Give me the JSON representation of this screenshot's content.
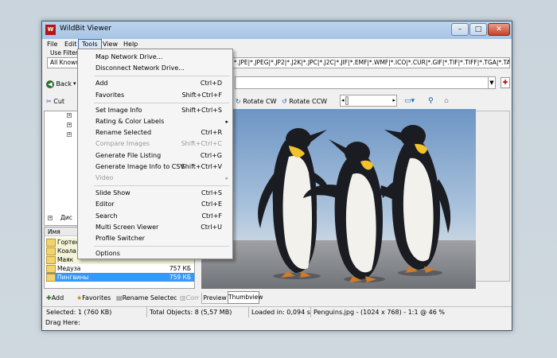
{
  "window": {
    "title": "WildBit Viewer",
    "icon_text": "W"
  },
  "menubar": {
    "items": [
      {
        "label": "File"
      },
      {
        "label": "Edit"
      },
      {
        "label": "Tools"
      },
      {
        "label": "View"
      },
      {
        "label": "Help"
      }
    ]
  },
  "filter": {
    "label": "Use Filter",
    "select_value": "All Known",
    "extensions": "*.JPE|*.JPEG|*.JP2|*.J2K|*.JPC|*.J2C|*.JIF|*.EMF|*.WMF|*.ICO|*.CUR|*.GIF|*.TIF|*.TIFF|*.TGA|*.TARG"
  },
  "nav": {
    "back_label": "Back"
  },
  "toolbar": {
    "cut_label": "Cut",
    "rotate_cw": "Rotate CW",
    "rotate_ccw": "Rotate CCW"
  },
  "tools_menu": {
    "items": [
      {
        "label": "Map Network Drive...",
        "shortcut": "",
        "disabled": false,
        "submenu": false
      },
      {
        "label": "Disconnect Network Drive...",
        "shortcut": "",
        "disabled": false,
        "submenu": false
      },
      {
        "separator": true
      },
      {
        "label": "Add",
        "shortcut": "Ctrl+D",
        "disabled": false,
        "submenu": false
      },
      {
        "label": "Favorites",
        "shortcut": "Shift+Ctrl+F",
        "disabled": false,
        "submenu": false
      },
      {
        "separator": true
      },
      {
        "label": "Set Image Info",
        "shortcut": "Shift+Ctrl+S",
        "disabled": false,
        "submenu": false
      },
      {
        "label": "Rating & Color Labels",
        "shortcut": "",
        "disabled": false,
        "submenu": true
      },
      {
        "label": "Rename Selected",
        "shortcut": "Ctrl+R",
        "disabled": false,
        "submenu": false
      },
      {
        "label": "Compare Images",
        "shortcut": "Shift+Ctrl+C",
        "disabled": true,
        "submenu": false
      },
      {
        "label": "Generate File Listing",
        "shortcut": "Ctrl+G",
        "disabled": false,
        "submenu": false
      },
      {
        "label": "Generate Image Info to CSV",
        "shortcut": "Shift+Ctrl+V",
        "disabled": false,
        "submenu": false
      },
      {
        "label": "Video",
        "shortcut": "",
        "disabled": true,
        "submenu": true
      },
      {
        "separator": true
      },
      {
        "label": "Slide Show",
        "shortcut": "Ctrl+S",
        "disabled": false,
        "submenu": false
      },
      {
        "label": "Editor",
        "shortcut": "Ctrl+E",
        "disabled": false,
        "submenu": false
      },
      {
        "label": "Search",
        "shortcut": "Ctrl+F",
        "disabled": false,
        "submenu": false
      },
      {
        "label": "Multi Screen Viewer",
        "shortcut": "Ctrl+U",
        "disabled": false,
        "submenu": false
      },
      {
        "label": "Profile Switcher",
        "shortcut": "",
        "disabled": false,
        "submenu": false
      },
      {
        "separator": true
      },
      {
        "label": "Options",
        "shortcut": "",
        "disabled": false,
        "submenu": false
      }
    ]
  },
  "file_panel": {
    "tree_label": "Дис",
    "column_name": "Имя",
    "files": [
      {
        "name": "Гортен",
        "size": ""
      },
      {
        "name": "Коала",
        "size": ""
      },
      {
        "name": "Маяк",
        "size": ""
      },
      {
        "name": "Медуза",
        "size": "757 КБ"
      },
      {
        "name": "Пингвины",
        "size": "759 КБ",
        "selected": true
      }
    ]
  },
  "bottom_toolbar": {
    "add": "Add",
    "favorites": "Favorites",
    "rename": "Rename Selected",
    "compare": "Comp"
  },
  "view_tabs": {
    "preview": "Preview",
    "thumbview": "Thumbview"
  },
  "status": {
    "selected": "Selected: 1 (760 KB)",
    "total": "Total Objects: 8 (5,57 MB)",
    "loaded": "Loaded in: 0,094 s",
    "fileinfo": "Penguins.jpg - (1024 x 768) - 1:1 @ 46  %",
    "drag": "Drag Here:"
  },
  "icons": {
    "app": "app-logo-icon",
    "back": "back-arrow-icon",
    "cut": "scissors-icon",
    "rotate_cw": "rotate-cw-icon",
    "rotate_ccw": "rotate-ccw-icon",
    "monitor": "monitor-icon",
    "zoom": "zoom-icon",
    "options": "settings-icon"
  },
  "colors": {
    "accent": "#3399ff",
    "selected_row": "#3399ff"
  }
}
